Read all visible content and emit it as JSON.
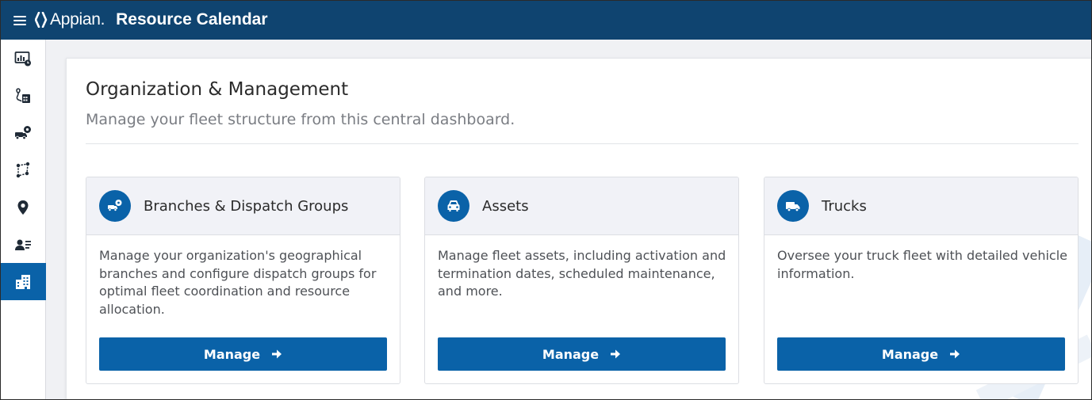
{
  "header": {
    "logo_text": "Appian.",
    "app_title": "Resource Calendar",
    "bg_color": "#0f4470"
  },
  "sidebar": {
    "items": [
      {
        "icon": "dashboard-icon",
        "active": false
      },
      {
        "icon": "schedule-calendar-icon",
        "active": false
      },
      {
        "icon": "dispatch-icon",
        "active": false
      },
      {
        "icon": "route-icon",
        "active": false
      },
      {
        "icon": "map-pin-icon",
        "active": false
      },
      {
        "icon": "user-list-icon",
        "active": false
      },
      {
        "icon": "building-icon",
        "active": true
      }
    ],
    "active_color": "#0a62a8"
  },
  "main": {
    "title": "Organization & Management",
    "subtitle": "Manage your fleet structure from this central dashboard.",
    "cards": [
      {
        "title": "Branches & Dispatch Groups",
        "icon": "branches-icon",
        "description": "Manage your organization's geographical branches and configure dispatch groups for optimal fleet coordination and resource allocation.",
        "button_label": "Manage"
      },
      {
        "title": "Assets",
        "icon": "car-icon",
        "description": "Manage fleet assets, including activation and termination dates, scheduled maintenance, and more.",
        "button_label": "Manage"
      },
      {
        "title": "Trucks",
        "icon": "truck-icon",
        "description": "Oversee your truck fleet with detailed vehicle information.",
        "button_label": "Manage"
      }
    ]
  }
}
